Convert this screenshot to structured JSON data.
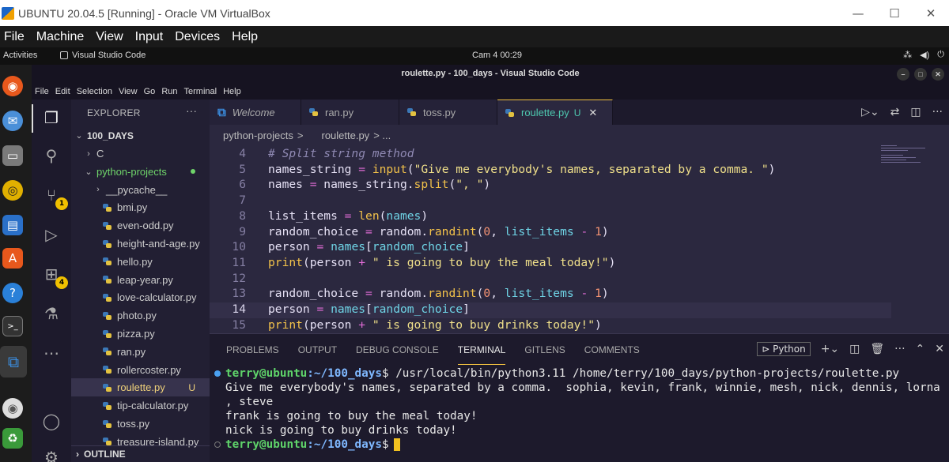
{
  "vbox": {
    "title": "UBUNTU 20.04.5 [Running] - Oracle VM VirtualBox",
    "menu": [
      "File",
      "Machine",
      "View",
      "Input",
      "Devices",
      "Help"
    ]
  },
  "ubuntu_bar": {
    "activities": "Activities",
    "app": "Visual Studio Code",
    "clock": "Cam 4  00:29"
  },
  "vscode": {
    "window_title": "roulette.py - 100_days - Visual Studio Code",
    "menu": [
      "File",
      "Edit",
      "Selection",
      "View",
      "Go",
      "Run",
      "Terminal",
      "Help"
    ],
    "badges": {
      "source_control": "1",
      "extensions": "4"
    }
  },
  "explorer": {
    "header": "EXPLORER",
    "root": "100_DAYS",
    "items": [
      {
        "label": "C",
        "kind": "folder",
        "expanded": false
      },
      {
        "label": "python-projects",
        "kind": "folder",
        "expanded": true
      },
      {
        "label": "__pycache__",
        "kind": "folder",
        "expanded": false
      },
      {
        "label": "bmi.py",
        "kind": "file"
      },
      {
        "label": "even-odd.py",
        "kind": "file"
      },
      {
        "label": "height-and-age.py",
        "kind": "file"
      },
      {
        "label": "hello.py",
        "kind": "file"
      },
      {
        "label": "leap-year.py",
        "kind": "file"
      },
      {
        "label": "love-calculator.py",
        "kind": "file"
      },
      {
        "label": "photo.py",
        "kind": "file"
      },
      {
        "label": "pizza.py",
        "kind": "file"
      },
      {
        "label": "ran.py",
        "kind": "file"
      },
      {
        "label": "rollercoster.py",
        "kind": "file"
      },
      {
        "label": "roulette.py",
        "kind": "file",
        "status": "U",
        "selected": true
      },
      {
        "label": "tip-calculator.py",
        "kind": "file"
      },
      {
        "label": "toss.py",
        "kind": "file"
      },
      {
        "label": "treasure-island.py",
        "kind": "file"
      }
    ],
    "outline": "OUTLINE"
  },
  "tabs": [
    {
      "label": "Welcome",
      "kind": "welcome"
    },
    {
      "label": "ran.py",
      "kind": "py"
    },
    {
      "label": "toss.py",
      "kind": "py"
    },
    {
      "label": "roulette.py",
      "kind": "py",
      "modified": "U",
      "active": true
    }
  ],
  "breadcrumb": [
    "python-projects",
    ">",
    "roulette.py",
    "> ..."
  ],
  "code": [
    {
      "n": "4",
      "html": "<span class=\"cm\"># Split string method</span>"
    },
    {
      "n": "5",
      "html": "names_string <span class=\"op\">=</span> <span class=\"fn\">input</span>(<span class=\"str\">\"Give me everybody's names, separated by a comma. \"</span>)"
    },
    {
      "n": "6",
      "html": "names <span class=\"op\">=</span> names_string.<span class=\"fn\">split</span>(<span class=\"str\">\", \"</span>)"
    },
    {
      "n": "7",
      "html": ""
    },
    {
      "n": "8",
      "html": "list_items <span class=\"op\">=</span> <span class=\"fn\">len</span>(<span class=\"ac\">names</span>)"
    },
    {
      "n": "9",
      "html": "random_choice <span class=\"op\">=</span> random.<span class=\"fn\">randint</span>(<span class=\"num\">0</span>, <span class=\"ac\">list_items</span> <span class=\"op\">-</span> <span class=\"num\">1</span>)"
    },
    {
      "n": "10",
      "html": "person <span class=\"op\">=</span> <span class=\"ac\">names</span>[<span class=\"ac\">random_choice</span>]"
    },
    {
      "n": "11",
      "html": "<span class=\"fn\">print</span>(person <span class=\"op\">+</span> <span class=\"str\">\" is going to buy the meal today!\"</span>)"
    },
    {
      "n": "12",
      "html": ""
    },
    {
      "n": "13",
      "html": "random_choice <span class=\"op\">=</span> random.<span class=\"fn\">randint</span>(<span class=\"num\">0</span>, <span class=\"ac\">list_items</span> <span class=\"op\">-</span> <span class=\"num\">1</span>)"
    },
    {
      "n": "14",
      "html": "person <span class=\"op\">=</span> <span class=\"ac\">names</span>[<span class=\"ac\">random_choice</span>]",
      "current": true
    },
    {
      "n": "15",
      "html": "<span class=\"fn\">print</span>(person <span class=\"op\">+</span> <span class=\"str\">\" is going to buy drinks today!\"</span>)"
    }
  ],
  "panel": {
    "tabs": [
      "PROBLEMS",
      "OUTPUT",
      "DEBUG CONSOLE",
      "TERMINAL",
      "GITLENS",
      "COMMENTS"
    ],
    "active_tab": "TERMINAL",
    "shell": "Python"
  },
  "terminal": {
    "prompt_user": "terry@ubuntu",
    "prompt_path": ":~/100_days",
    "prompt_sym": "$",
    "command": " /usr/local/bin/python3.11 /home/terry/100_days/python-projects/roulette.py",
    "output": [
      "Give me everybody's names, separated by a comma.  sophia, kevin, frank, winnie, mesh, nick, dennis, lorna",
      ", steve",
      "frank is going to buy the meal today!",
      "nick is going to buy drinks today!"
    ]
  }
}
